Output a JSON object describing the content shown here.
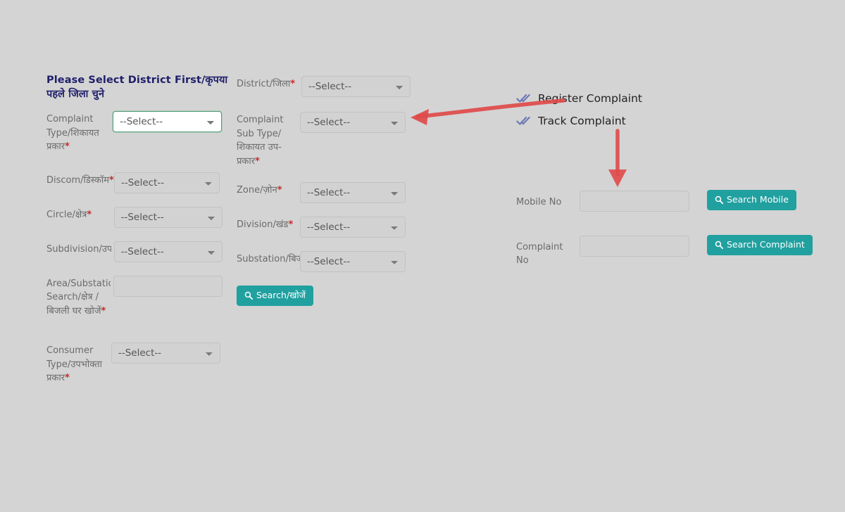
{
  "page": {
    "background_color": "#d4d4d4",
    "title": "Please Select District First/कृपया पहले जिला चुने"
  },
  "theme": {
    "accent": "#21a0a0",
    "title_color": "#1f1f6b",
    "required_color": "#c92a2a",
    "focus_border": "#4e9e7a",
    "annotation_color": "#e04a4a",
    "check_color": "#6a77b5"
  },
  "form": {
    "left_column": [
      {
        "label": "Complaint Type/शिकायत प्रकार",
        "required": true,
        "control": "select",
        "value": "--Select--",
        "state": "focused",
        "name": "complaint-type-select"
      },
      {
        "label": "Discom/डिस्कॉम",
        "required": true,
        "control": "select",
        "value": "--Select--",
        "state": "normal",
        "name": "discom-select"
      },
      {
        "label": "Circle/क्षेत्र",
        "required": true,
        "control": "select",
        "value": "--Select--",
        "state": "normal",
        "name": "circle-select"
      },
      {
        "label": "Subdivision/उपखंड",
        "required": true,
        "control": "select",
        "value": "--Select--",
        "state": "normal",
        "name": "subdivision-select"
      },
      {
        "label": "Area/Substation Search/क्षेत्र / बिजली घर खोजें",
        "required": true,
        "control": "input",
        "value": "",
        "placeholder": "",
        "state": "normal",
        "name": "area-substation-search-input"
      },
      {
        "label": "Consumer Type/उपभोक्ता प्रकार",
        "required": true,
        "control": "select",
        "value": "--Select--",
        "state": "muted",
        "name": "consumer-type-select"
      }
    ],
    "mid_column": [
      {
        "label": "District/जिला",
        "required": true,
        "control": "select",
        "value": "--Select--",
        "state": "normal",
        "name": "district-select"
      },
      {
        "label": "Complaint Sub Type/शिकायत उप-प्रकार",
        "required": true,
        "control": "select",
        "value": "--Select--",
        "state": "normal",
        "name": "complaint-sub-type-select"
      },
      {
        "label": "Zone/ज़ोन",
        "required": true,
        "control": "select",
        "value": "--Select--",
        "state": "normal",
        "name": "zone-select"
      },
      {
        "label": "Division/खंड",
        "required": true,
        "control": "select",
        "value": "--Select--",
        "state": "normal",
        "name": "division-select"
      },
      {
        "label": "Substation/बिजली घर",
        "required": true,
        "control": "select",
        "value": "--Select--",
        "state": "normal",
        "name": "substation-select"
      }
    ],
    "search_button": {
      "label": "Search/खोजें",
      "icon": "search-icon"
    }
  },
  "sidebar": {
    "links": [
      {
        "label": "Register Complaint",
        "icon": "double-check-icon"
      },
      {
        "label": "Track Complaint",
        "icon": "double-check-icon"
      }
    ]
  },
  "track": {
    "mobile": {
      "label": "Mobile No",
      "value": "",
      "placeholder": "",
      "button_label": "Search Mobile",
      "button_icon": "search-icon"
    },
    "complaint": {
      "label": "Complaint No",
      "value": "",
      "placeholder": "",
      "button_label": "Search Complaint",
      "button_icon": "search-icon"
    }
  },
  "annotations": [
    {
      "type": "arrow",
      "direction": "left",
      "name": "arrow-to-complaint-sub-type"
    },
    {
      "type": "arrow",
      "direction": "down",
      "name": "arrow-to-mobile-no"
    }
  ]
}
